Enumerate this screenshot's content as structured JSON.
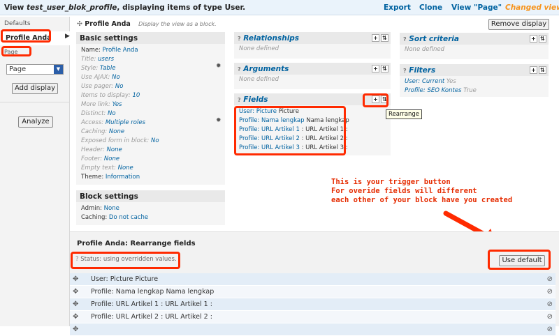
{
  "header": {
    "view_prefix": "View",
    "view_name": "test_user_blok_profile",
    "view_suffix": ", displaying items of type User.",
    "export": "Export",
    "clone": "Clone",
    "view_page": "View \"Page\"",
    "changed": "Changed view"
  },
  "sidebar": {
    "defaults": "Defaults",
    "profile_anda": "Profile Anda",
    "page": "Page",
    "select_value": "Page",
    "add_display": "Add display",
    "analyze": "Analyze"
  },
  "display": {
    "title": "Profile Anda",
    "description": "Display the view as a block.",
    "remove_display": "Remove display"
  },
  "basic_settings": {
    "heading": "Basic settings",
    "rows": [
      {
        "label": "Name:",
        "value": "Profile Anda",
        "dim": false
      },
      {
        "label": "Title:",
        "value": "users",
        "dim": true
      },
      {
        "label": "Style:",
        "value": "Table",
        "dim": true
      },
      {
        "label": "Use AJAX:",
        "value": "No",
        "dim": true
      },
      {
        "label": "Use pager:",
        "value": "No",
        "dim": true
      },
      {
        "label": "Items to display:",
        "value": "10",
        "dim": true
      },
      {
        "label": "More link:",
        "value": "Yes",
        "dim": true
      },
      {
        "label": "Distinct:",
        "value": "No",
        "dim": true
      },
      {
        "label": "Access:",
        "value": "Multiple roles",
        "dim": true
      },
      {
        "label": "Caching:",
        "value": "None",
        "dim": true
      },
      {
        "label": "Exposed form in block:",
        "value": "No",
        "dim": true
      },
      {
        "label": "Header:",
        "value": "None",
        "dim": true
      },
      {
        "label": "Footer:",
        "value": "None",
        "dim": true
      },
      {
        "label": "Empty text:",
        "value": "None",
        "dim": true
      },
      {
        "label": "Theme:",
        "value": "Information",
        "dim": false
      }
    ]
  },
  "block_settings": {
    "heading": "Block settings",
    "rows": [
      {
        "label": "Admin:",
        "value": "None"
      },
      {
        "label": "Caching:",
        "value": "Do not cache"
      }
    ]
  },
  "relationships": {
    "heading": "Relationships",
    "empty": "None defined"
  },
  "arguments": {
    "heading": "Arguments",
    "empty": "None defined"
  },
  "fields": {
    "heading": "Fields",
    "items": [
      {
        "link": "User: Picture",
        "text": "Picture"
      },
      {
        "link": "Profile: Nama lengkap",
        "text": "Nama lengkap"
      },
      {
        "link": "Profile: URL Artikel 1",
        "text": ": URL Artikel 1 :"
      },
      {
        "link": "Profile: URL Artikel 2",
        "text": ": URL Artikel 2 :"
      },
      {
        "link": "Profile: URL Artikel 3",
        "text": ": URL Artikel 3 :"
      }
    ],
    "tooltip": "Rearrange"
  },
  "sort_criteria": {
    "heading": "Sort criteria",
    "empty": "None defined"
  },
  "filters": {
    "heading": "Filters",
    "items": [
      {
        "link": "User: Current",
        "text": "Yes"
      },
      {
        "link": "Profile: SEO Kontes",
        "text": "True"
      }
    ]
  },
  "annotation": {
    "text": "This is your trigger button\nFor overide fields will different\neach other of your block have you created"
  },
  "rearrange": {
    "title": "Profile Anda: Rearrange fields",
    "status": "Status: using overridden values.",
    "use_default": "Use default",
    "rows": [
      "User: Picture Picture",
      "Profile: Nama lengkap Nama lengkap",
      "Profile: URL Artikel 1 : URL Artikel 1 :",
      "Profile: URL Artikel 2 : URL Artikel 2 :",
      ""
    ]
  },
  "colors": {
    "highlight": "#ff2a00",
    "link": "#0062a0",
    "changed": "#f7941d"
  }
}
